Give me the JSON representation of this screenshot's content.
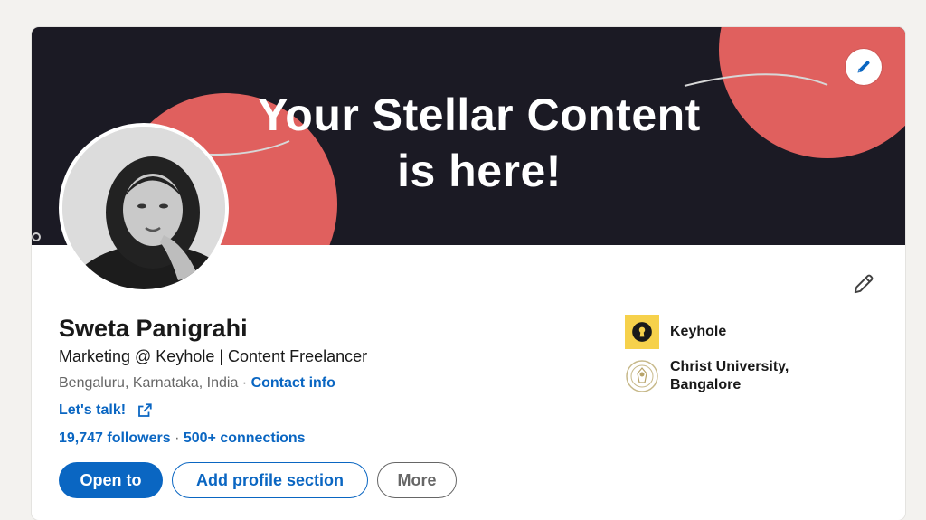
{
  "banner": {
    "headline_line1": "Your Stellar Content",
    "headline_line2": "is here!",
    "colors": {
      "background": "#1b1a24",
      "accent": "#e0605e"
    }
  },
  "profile": {
    "name": "Sweta Panigrahi",
    "headline": "Marketing @ Keyhole | Content Freelancer",
    "location": "Bengaluru, Karnataka, India",
    "separator": " · ",
    "contact_label": "Contact info",
    "website_label": "Let's talk!",
    "followers": "19,747 followers",
    "stats_separator": " · ",
    "connections": "500+ connections"
  },
  "actions": {
    "open_to": "Open to",
    "add_section": "Add profile section",
    "more": "More"
  },
  "aside": {
    "company": "Keyhole",
    "school_line1": "Christ University,",
    "school_line2": "Bangalore"
  },
  "icons": {
    "banner_edit": "pencil-icon",
    "intro_edit": "pencil-icon",
    "external_link": "external-link-icon",
    "company_logo": "keyhole-logo-icon",
    "school_logo": "university-seal-icon"
  },
  "colors": {
    "link": "#0a66c2",
    "keyhole_logo_bg": "#f6d14b"
  }
}
